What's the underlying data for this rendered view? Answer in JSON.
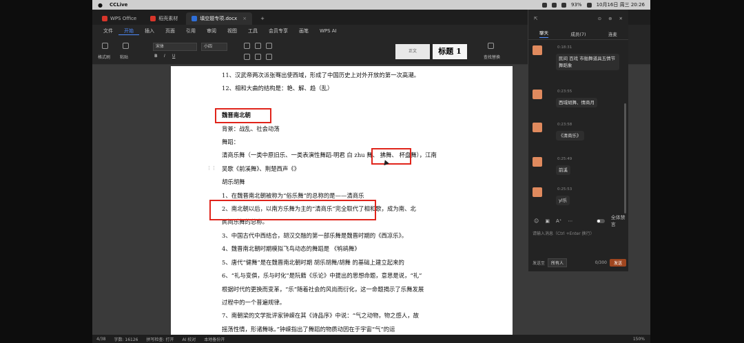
{
  "menubar": {
    "app": "CCLive",
    "battery": "93%",
    "datetime": "10月16日 周三 20:26"
  },
  "tabs": [
    {
      "label": "WPS Office",
      "active": false,
      "color": "#d8352a"
    },
    {
      "label": "稻壳素材",
      "active": false,
      "color": "#d8352a"
    },
    {
      "label": "填空题专项.docx",
      "active": true,
      "color": "#2f6fd8"
    }
  ],
  "ribbon": {
    "file": "文件",
    "menus": [
      "开始",
      "插入",
      "页面",
      "引用",
      "审阅",
      "视图",
      "工具",
      "会员专享",
      "画笔",
      "WPS AI"
    ],
    "active": "开始",
    "format_painter": "格式刷",
    "paste": "粘贴",
    "font": "宋体",
    "size": "小四",
    "style_normal": "正文",
    "style_title": "标题 1",
    "find_replace": "查找替换"
  },
  "document": {
    "lines": [
      {
        "text": "11、汉武帝两次派张骞出使西域，形成了中国历史上对外开放的第一次高潮。",
        "bold": false
      },
      {
        "text": "12、相和大曲的结构是：艳、解、趋（乱）",
        "bold": false
      },
      {
        "text": "",
        "bold": false
      },
      {
        "text": "魏晋南北朝",
        "bold": true
      },
      {
        "text": "背景：战乱、社会动荡",
        "bold": false
      },
      {
        "text": "舞蹈：",
        "bold": false
      },
      {
        "text": "清商乐舞（一类中原旧乐、一类表演性舞蹈-明君  白 zhu 舞、 拂舞、 杯盘舞），江南",
        "bold": false
      },
      {
        "text": "吴歌《前溪舞》、荆楚西声《》",
        "bold": false
      },
      {
        "text": "胡乐胡舞",
        "bold": false
      },
      {
        "text": "1、在魏晋南北朝被称为“俗乐舞”的总称的是——清商乐",
        "bold": false
      },
      {
        "text": "2、南北朝以后，以南方乐舞为主的“清商乐”完全取代了相和歌，成为南、北",
        "bold": false
      },
      {
        "text": "民间乐舞的总称。",
        "bold": false
      },
      {
        "text": "3、中国古代中西结合，胡汉交融的第一部乐舞是魏晋时期的《西凉乐》。",
        "bold": false
      },
      {
        "text": "4、魏晋南北朝时期模拟飞鸟动态的舞蹈是 《鸲鹆舞》",
        "bold": false
      },
      {
        "text": "5、唐代“健舞”是在魏晋南北朝时期 胡乐胡舞/胡舞 的基础上建立起来的",
        "bold": false
      },
      {
        "text": "6、“礼与变俱，乐与时化”是阮籍《乐论》中提出的思想命题，意思是说，“礼”",
        "bold": false
      },
      {
        "text": "根据时代的更换而变革，“乐”随着社会的风尚而衍化，这一命题揭示了乐舞发展",
        "bold": false
      },
      {
        "text": "过程中的一个普遍规律。",
        "bold": false
      },
      {
        "text": "7、南朝梁的文学批评家钟嵘在其《诗品序》中说：“气之动物，物之感人，故",
        "bold": false
      },
      {
        "text": "摇荡性情，形诸舞咏。”钟嵘指出了舞蹈的物质动因在于宇宙“气”的运",
        "bold": false
      }
    ]
  },
  "status": {
    "page": "4/38",
    "words": "字数: 16126",
    "spell": "拼写检查: 打开",
    "ai": "AI 校对",
    "backup": "本地备份开",
    "zoom": "150%"
  },
  "chat": {
    "tabs": [
      "聊天",
      "成员(7)",
      "连麦"
    ],
    "active_tab": "聊天",
    "messages": [
      {
        "time": "0:18:31",
        "text": "民间 百戏 市舶舞道具五情节舞蹈象"
      },
      {
        "time": "0:23:55",
        "text": "西域胡舞、情商月"
      },
      {
        "time": "0:23:58",
        "text": "《清商乐》"
      },
      {
        "time": "0:25:49",
        "text": "前溪"
      },
      {
        "time": "0:25:53",
        "text": "yl乐"
      }
    ],
    "mute_all": "全体禁言",
    "input_placeholder": "请输入消息（Ctrl +Enter 换行）",
    "send_to_label": "发送至",
    "send_to_value": "所有人",
    "counter": "0/300",
    "send": "发送"
  }
}
